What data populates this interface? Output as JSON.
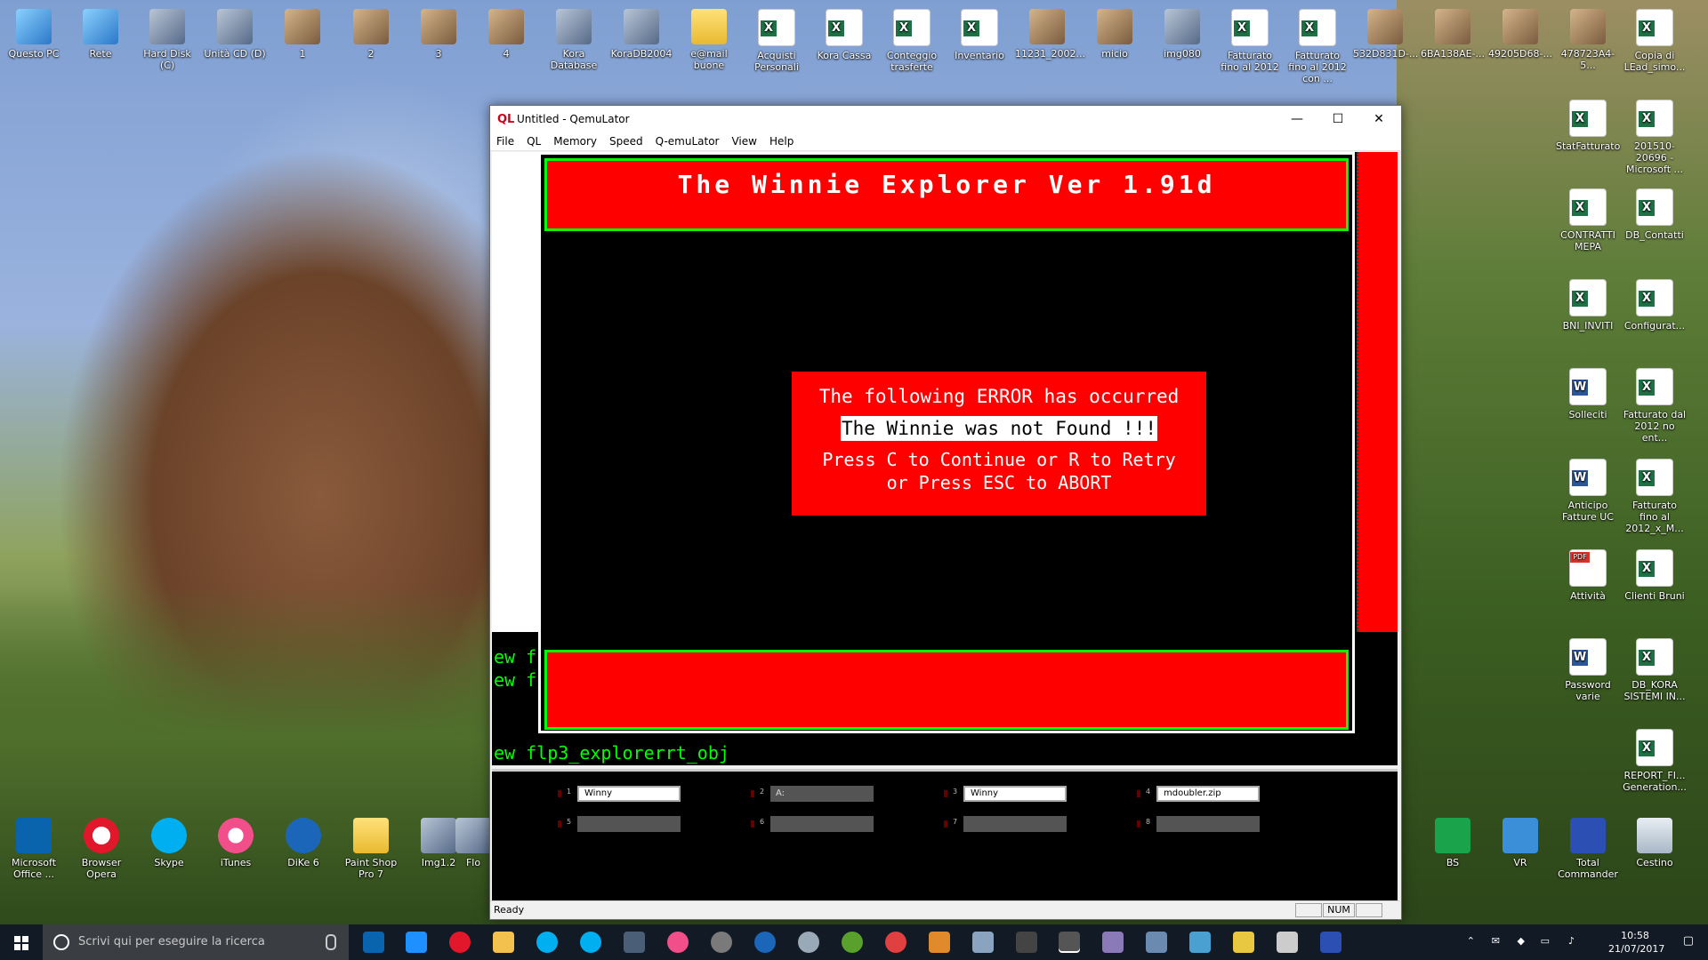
{
  "desktop": {
    "top_icons": [
      "Questo PC",
      "Rete",
      "Hard Disk (C)",
      "Unità CD (D)",
      "1",
      "2",
      "3",
      "4",
      "Kora Database",
      "KoraDB2004",
      "e@mail buone",
      "Acquisti Personali",
      "Kora Cassa",
      "Conteggio trasferte",
      "Inventario",
      "11231_2002...",
      "micio",
      "img080",
      "Fatturato fino al 2012",
      "Fatturato fino al 2012 con ...",
      "532D831D-...",
      "6BA138AE-...",
      "49205D68-...",
      "478723A4-5...",
      "Copia di LEad_simo..."
    ],
    "right_icons": [
      "StatFatturato",
      "201510-20696 - Microsoft ...",
      "CONTRATTI MEPA",
      "DB_Contatti",
      "BNI_INVITI",
      "Configurat...",
      "Solleciti",
      "Fatturato dal 2012 no ent...",
      "Anticipo Fatture UC",
      "Fatturato fino al 2012_x_M...",
      "Attività",
      "Clienti Bruni",
      "Password varie",
      "DB_KORA SISTEMI IN...",
      "REPORT_FI... Generation..."
    ],
    "bottom_left_icons": [
      "Microsoft Office ...",
      "Browser Opera",
      "Skype",
      "iTunes",
      "DiKe 6",
      "Paint Shop Pro 7",
      "Img1.2",
      "Flo"
    ],
    "bottom_right_icons": [
      "BS",
      "VR",
      "Total Commander",
      "Cestino"
    ]
  },
  "window": {
    "app_icon": "QL",
    "title": "Untitled - QemuLator",
    "menu": [
      "File",
      "QL",
      "Memory",
      "Speed",
      "Q-emuLator",
      "View",
      "Help"
    ],
    "controls": {
      "minimize": "—",
      "maximize": "☐",
      "close": "✕"
    },
    "status": {
      "ready": "Ready",
      "num": "NUM"
    }
  },
  "emulator": {
    "header": "The Winnie Explorer Ver 1.91d",
    "error_title": "The following ERROR has occurred",
    "error_message": "The Winnie was not Found !!!",
    "error_help_1": "Press C to Continue or R to Retry",
    "error_help_2": "or Press ESC to ABORT",
    "side_lines": [
      "ew f",
      "ew f"
    ],
    "command_line": "ew flp3_explorerrt_obj"
  },
  "drives": [
    {
      "num": "1",
      "value": "Winny",
      "selected": true
    },
    {
      "num": "2",
      "value": "A:",
      "selected": false
    },
    {
      "num": "3",
      "value": "Winny",
      "selected": true
    },
    {
      "num": "4",
      "value": "mdoubler.zip",
      "selected": true
    },
    {
      "num": "5",
      "value": "",
      "selected": false
    },
    {
      "num": "6",
      "value": "",
      "selected": false
    },
    {
      "num": "7",
      "value": "",
      "selected": false
    },
    {
      "num": "8",
      "value": "",
      "selected": false
    }
  ],
  "taskbar": {
    "search_placeholder": "Scrivi qui per eseguire la ricerca",
    "time": "10:58",
    "date": "21/07/2017"
  },
  "colors": {
    "ql_red": "#ff0000",
    "ql_green": "#00ff00",
    "taskbar": "#111a25"
  }
}
